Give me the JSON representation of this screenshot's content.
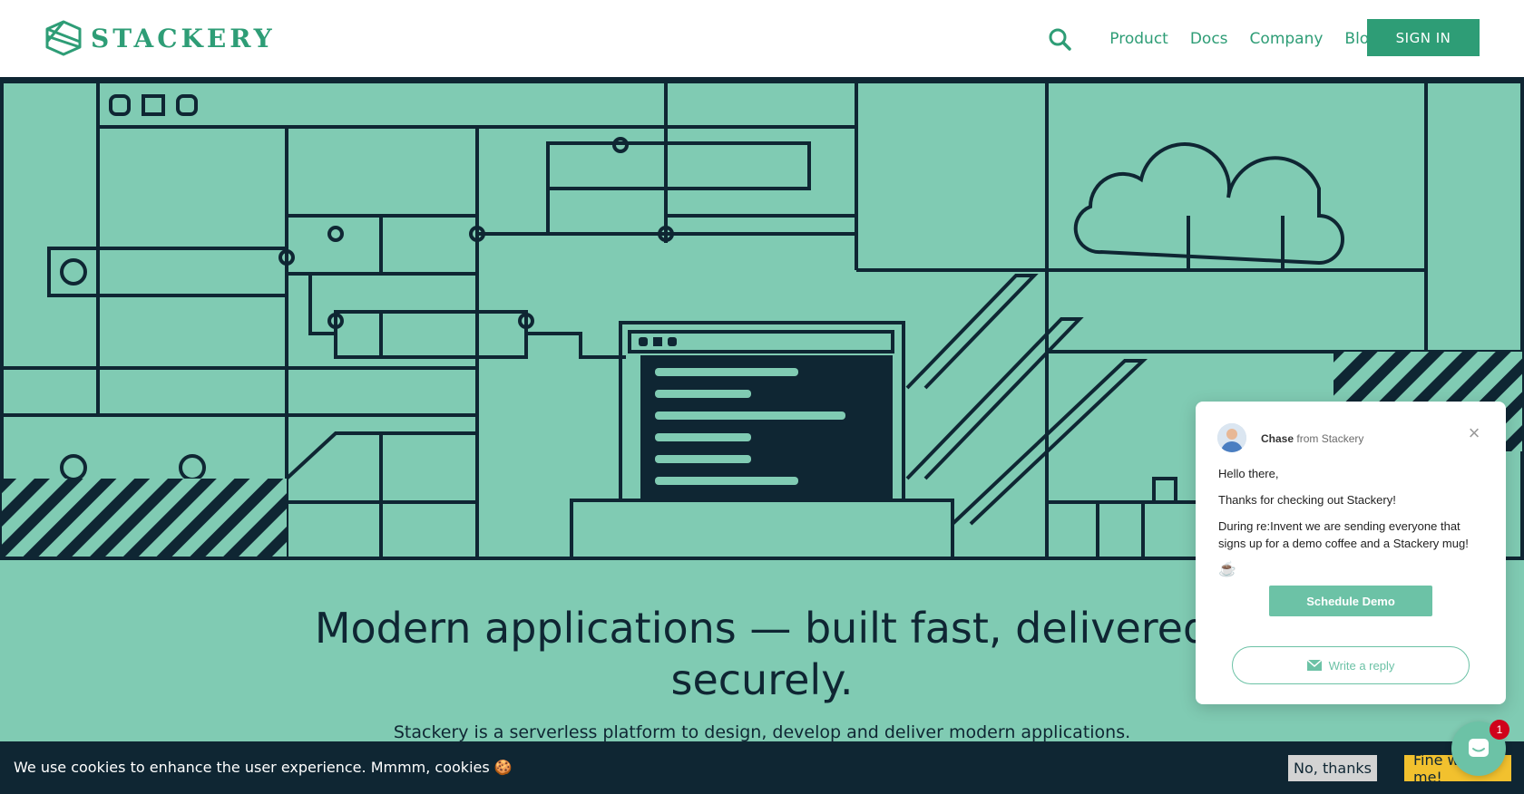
{
  "brand": {
    "name": "STACKERY",
    "color": "#2e9d76"
  },
  "nav": {
    "search_icon": "search-icon",
    "items": [
      "Product",
      "Docs",
      "Company",
      "Blog"
    ],
    "signin_label": "SIGN IN"
  },
  "hero": {
    "headline": "Modern applications — built fast, delivered securely.",
    "subline": "Stackery is a serverless platform to design, develop and deliver modern applications.",
    "background": "#80cbb3",
    "ink": "#0f2633"
  },
  "chat": {
    "sender_name": "Chase",
    "sender_org": "from Stackery",
    "messages": [
      "Hello there,",
      "Thanks for checking out Stackery!",
      "During re:Invent we are sending everyone that signs up for a demo coffee and a Stackery mug!"
    ],
    "emoji": "☕",
    "demo_button": "Schedule Demo",
    "reply_placeholder": "Write a reply",
    "accent": "#6cc2a6"
  },
  "launcher": {
    "badge_count": "1"
  },
  "cookie": {
    "text": "We use cookies to enhance the user experience. Mmmm, cookies 🍪",
    "decline": "No, thanks",
    "accept": "Fine with me!"
  }
}
